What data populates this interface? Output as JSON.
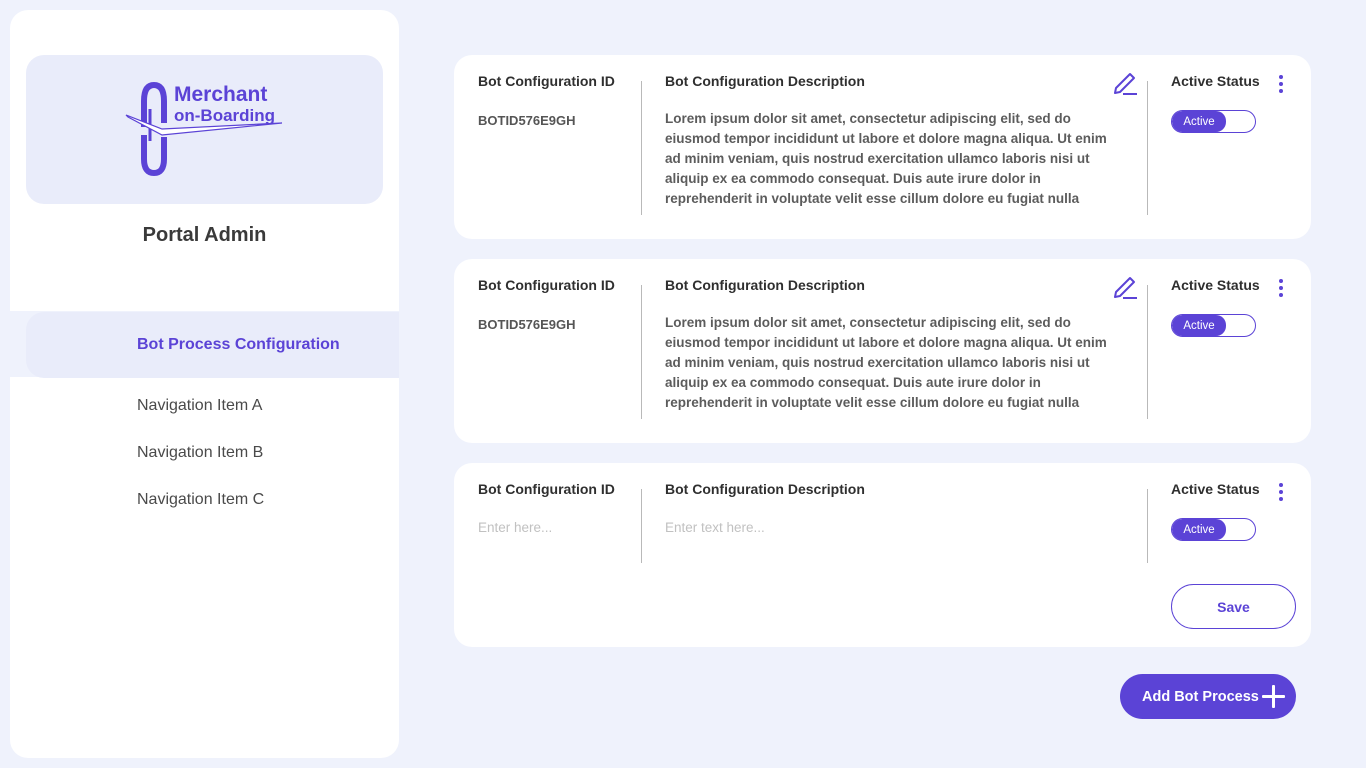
{
  "sidebar": {
    "logo": {
      "line1": "Merchant",
      "line2": "on-Boarding"
    },
    "title": "Portal Admin",
    "active_item": "Bot Process Configuration",
    "items": [
      "Navigation Item A",
      "Navigation Item B",
      "Navigation Item C"
    ]
  },
  "columns": {
    "id": "Bot Configuration ID",
    "description": "Bot Configuration Description",
    "status": "Active Status"
  },
  "cards": [
    {
      "id": "BOTID576E9GH",
      "description": "Lorem ipsum dolor sit amet, consectetur adipiscing elit, sed do eiusmod tempor incididunt ut labore et dolore magna aliqua. Ut enim ad minim veniam, quis nostrud exercitation ullamco laboris nisi ut aliquip ex ea commodo consequat. Duis aute irure dolor in reprehenderit in voluptate velit esse cillum dolore eu fugiat nulla",
      "status": "Active"
    },
    {
      "id": "BOTID576E9GH",
      "description": "Lorem ipsum dolor sit amet, consectetur adipiscing elit, sed do eiusmod tempor incididunt ut labore et dolore magna aliqua. Ut enim ad minim veniam, quis nostrud exercitation ullamco laboris nisi ut aliquip ex ea commodo consequat. Duis aute irure dolor in reprehenderit in voluptate velit esse cillum dolore eu fugiat nulla",
      "status": "Active"
    }
  ],
  "new_card": {
    "id_placeholder": "Enter here...",
    "description_placeholder": "Enter text here...",
    "status": "Active",
    "save_label": "Save"
  },
  "add_button": "Add Bot Process",
  "colors": {
    "accent": "#5b43d6",
    "background": "#eff2fc",
    "card": "#ffffff"
  }
}
